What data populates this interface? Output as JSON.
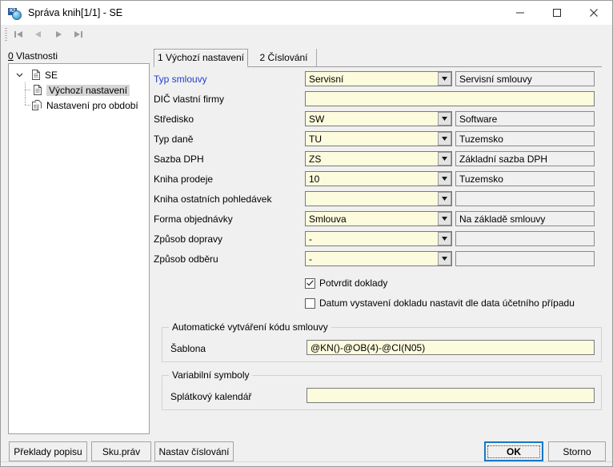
{
  "window": {
    "title": "Správa knih[1/1] - SE",
    "app_icon": "k2-disc-icon",
    "minimize": "minimize-icon",
    "maximize": "maximize-icon",
    "close": "close-icon"
  },
  "navbar": {
    "first_label": "first-record-icon",
    "prev_label": "previous-record-icon",
    "next_label": "next-record-icon",
    "last_label": "last-record-icon"
  },
  "left_panel": {
    "accelerator": "0",
    "label": " Vlastnosti",
    "tree": [
      {
        "label": "SE",
        "level": 0,
        "selected": false,
        "icon": "document-icon"
      },
      {
        "label": "Výchozí nastavení",
        "level": 1,
        "selected": true,
        "icon": "document-icon"
      },
      {
        "label": "Nastavení pro období",
        "level": 1,
        "selected": false,
        "icon": "documents-icon"
      }
    ]
  },
  "tabs": [
    {
      "label": "1 Výchozí nastavení",
      "active": true
    },
    {
      "label": "2 Číslování",
      "active": false
    }
  ],
  "form": {
    "rows": [
      {
        "label": "Typ smlouvy",
        "link": true,
        "type": "combo",
        "value": "Servisní",
        "desc": "Servisní smlouvy"
      },
      {
        "label": "DIČ vlastní firmy",
        "link": false,
        "type": "text",
        "value": "",
        "desc": null
      },
      {
        "label": "Středisko",
        "link": false,
        "type": "combo",
        "value": "SW",
        "desc": "Software"
      },
      {
        "label": "Typ daně",
        "link": false,
        "type": "combo",
        "value": "TU",
        "desc": "Tuzemsko"
      },
      {
        "label": "Sazba DPH",
        "link": false,
        "type": "combo",
        "value": "ZS",
        "desc": "Základní sazba DPH"
      },
      {
        "label": "Kniha prodeje",
        "link": false,
        "type": "combo",
        "value": "10",
        "desc": "Tuzemsko"
      },
      {
        "label": "Kniha ostatních pohledávek",
        "link": false,
        "type": "combo",
        "value": "",
        "desc": ""
      },
      {
        "label": "Forma objednávky",
        "link": false,
        "type": "combo",
        "value": "Smlouva",
        "desc": "Na základě smlouvy"
      },
      {
        "label": "Způsob dopravy",
        "link": false,
        "type": "combo",
        "value": "-",
        "desc": ""
      },
      {
        "label": "Způsob odběru",
        "link": false,
        "type": "combo",
        "value": "-",
        "desc": ""
      }
    ],
    "checkboxes": [
      {
        "label": "Potvrdit doklady",
        "checked": true
      },
      {
        "label": "Datum vystavení dokladu nastavit dle data účetního případu",
        "checked": false
      }
    ]
  },
  "groups": [
    {
      "title": "Automatické vytváření kódu smlouvy",
      "field_label": "Šablona",
      "field_value": "@KN()-@OB(4)-@CI(N05)"
    },
    {
      "title": "Variabilní symboly",
      "field_label": "Splátkový kalendář",
      "field_value": ""
    }
  ],
  "footer": {
    "translations_button": "Překlady popisu",
    "rights_button": "Sku.práv",
    "numbering_button": "Nastav číslování",
    "ok_button": "OK",
    "cancel_button": "Storno"
  },
  "colors": {
    "editable_field": "#fdfbdd",
    "readonly_field": "#f0f0f0",
    "link_label": "#1f3fd0",
    "focus_border": "#1577c8",
    "window_bg": "#f0f0f0"
  }
}
